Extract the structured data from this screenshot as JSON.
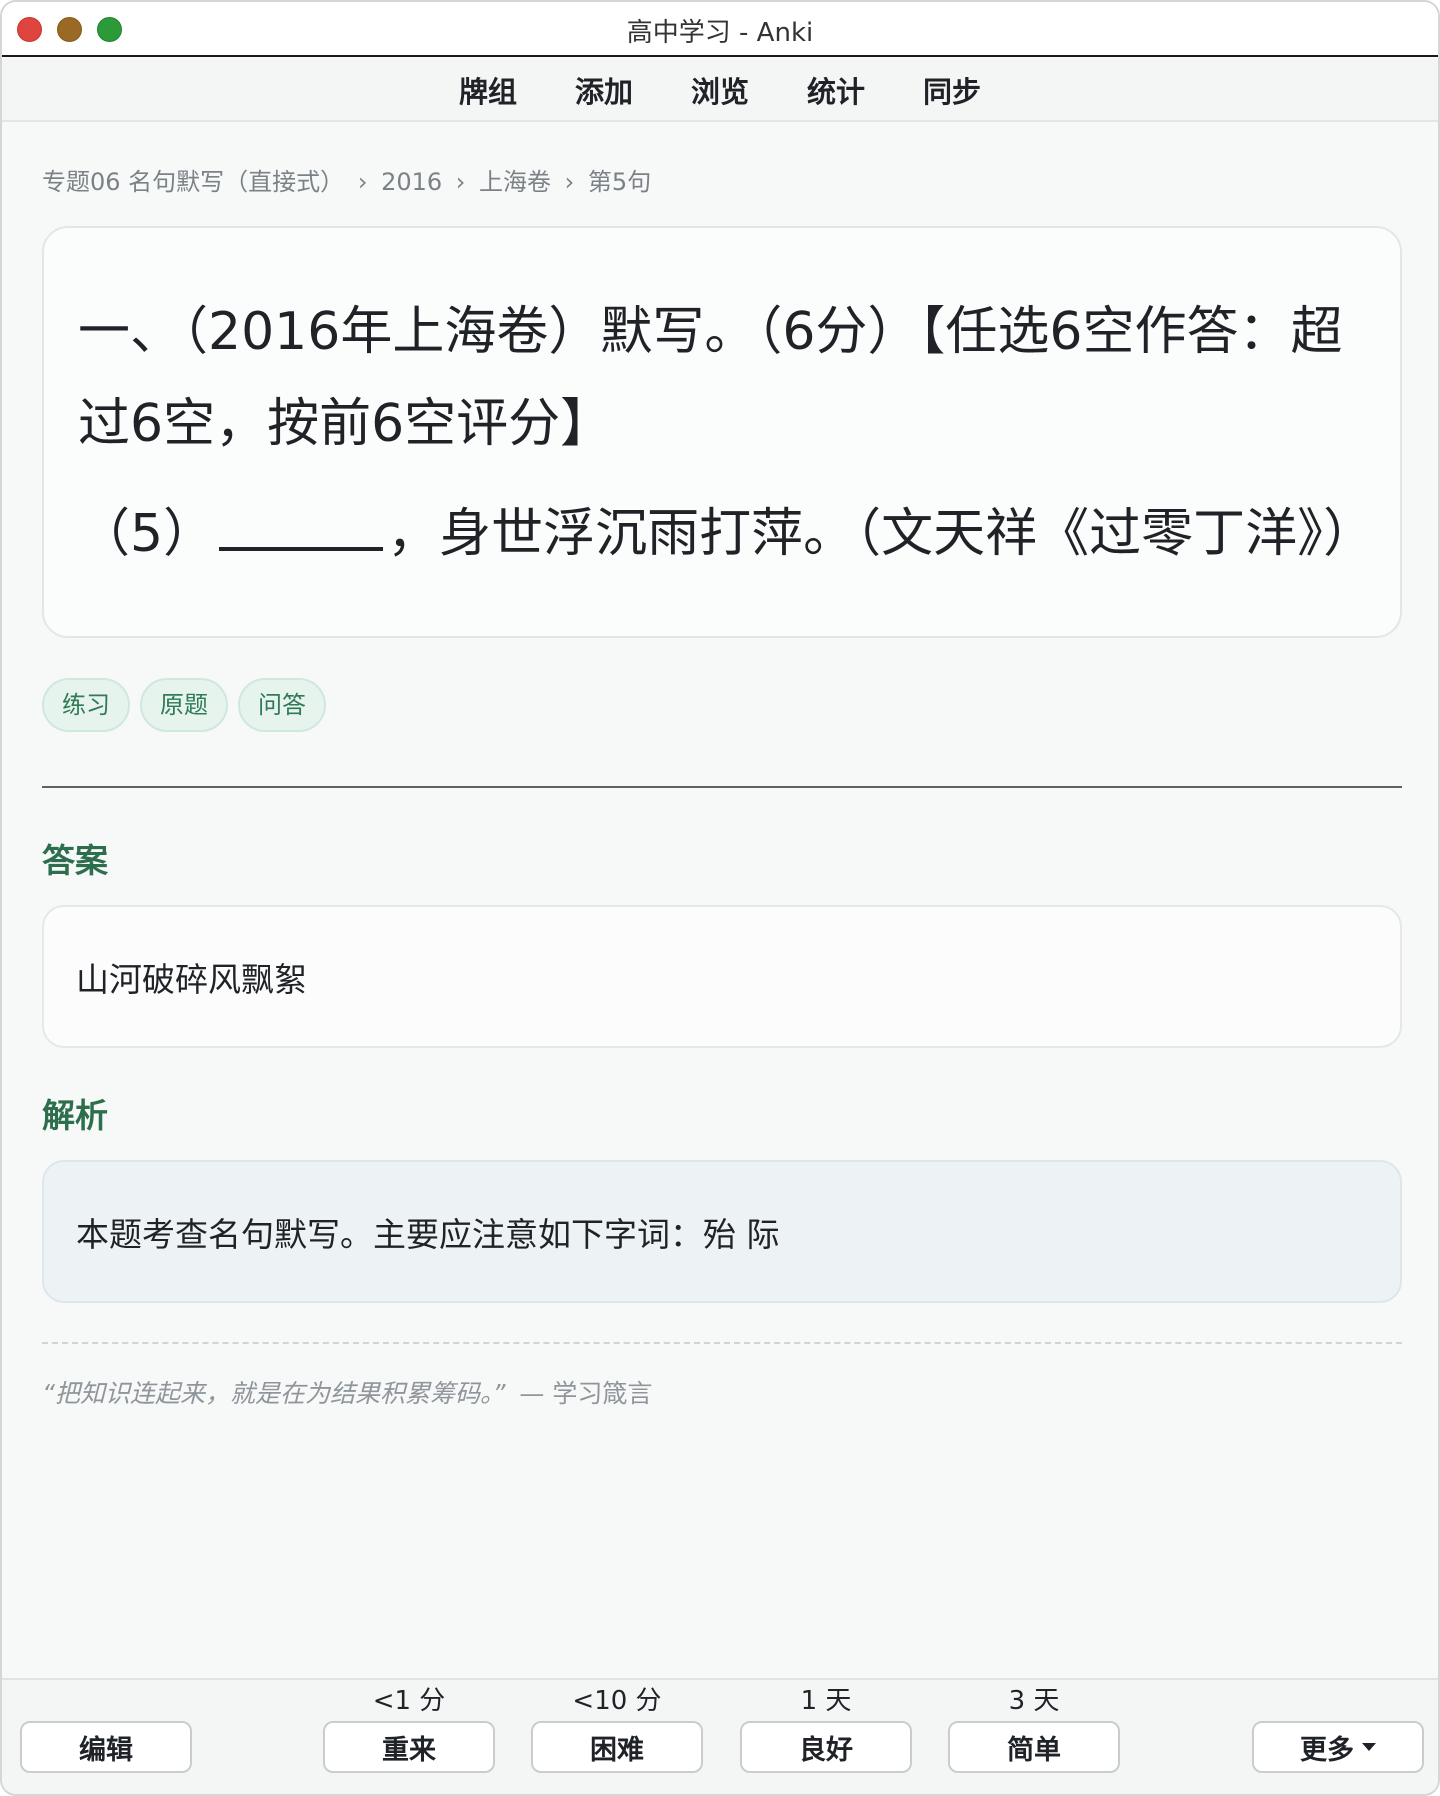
{
  "window": {
    "title": "高中学习 - Anki"
  },
  "nav": {
    "items": [
      "牌组",
      "添加",
      "浏览",
      "统计",
      "同步"
    ]
  },
  "breadcrumb": {
    "parts": [
      "专题06 名句默写（直接式）",
      "2016",
      "上海卷",
      "第5句"
    ],
    "separator": "›"
  },
  "question": {
    "line1": "一、（2016年上海卷）默写。（6分）【任选6空作答：超过6空，按前6空评分】",
    "line2_prefix": "（5）",
    "line2_suffix": "，身世浮沉雨打萍。（文天祥《过零丁洋》）"
  },
  "tags": [
    "练习",
    "原题",
    "问答"
  ],
  "answer": {
    "title": "答案",
    "text": "山河破碎风飘絮"
  },
  "analysis": {
    "title": "解析",
    "text": "本题考查名句默写。主要应注意如下字词：殆 际"
  },
  "quote": {
    "text": "“把知识连起来，就是在为结果积累筹码。”",
    "source": "— 学习箴言"
  },
  "bottom": {
    "edit_label": "编辑",
    "more_label": "更多",
    "answers": [
      {
        "interval": "<1 分",
        "label": "重来"
      },
      {
        "interval": "<10 分",
        "label": "困难"
      },
      {
        "interval": "1 天",
        "label": "良好"
      },
      {
        "interval": "3 天",
        "label": "简单"
      }
    ]
  },
  "colors": {
    "accent": "#2d6f4d",
    "tag_bg": "#e7f4ee",
    "analysis_bg": "#edf2f5"
  },
  "icons": {
    "close": "close-dot-icon",
    "minimize": "minimize-dot-icon",
    "zoom": "zoom-dot-icon",
    "more": "caret-down-icon"
  }
}
